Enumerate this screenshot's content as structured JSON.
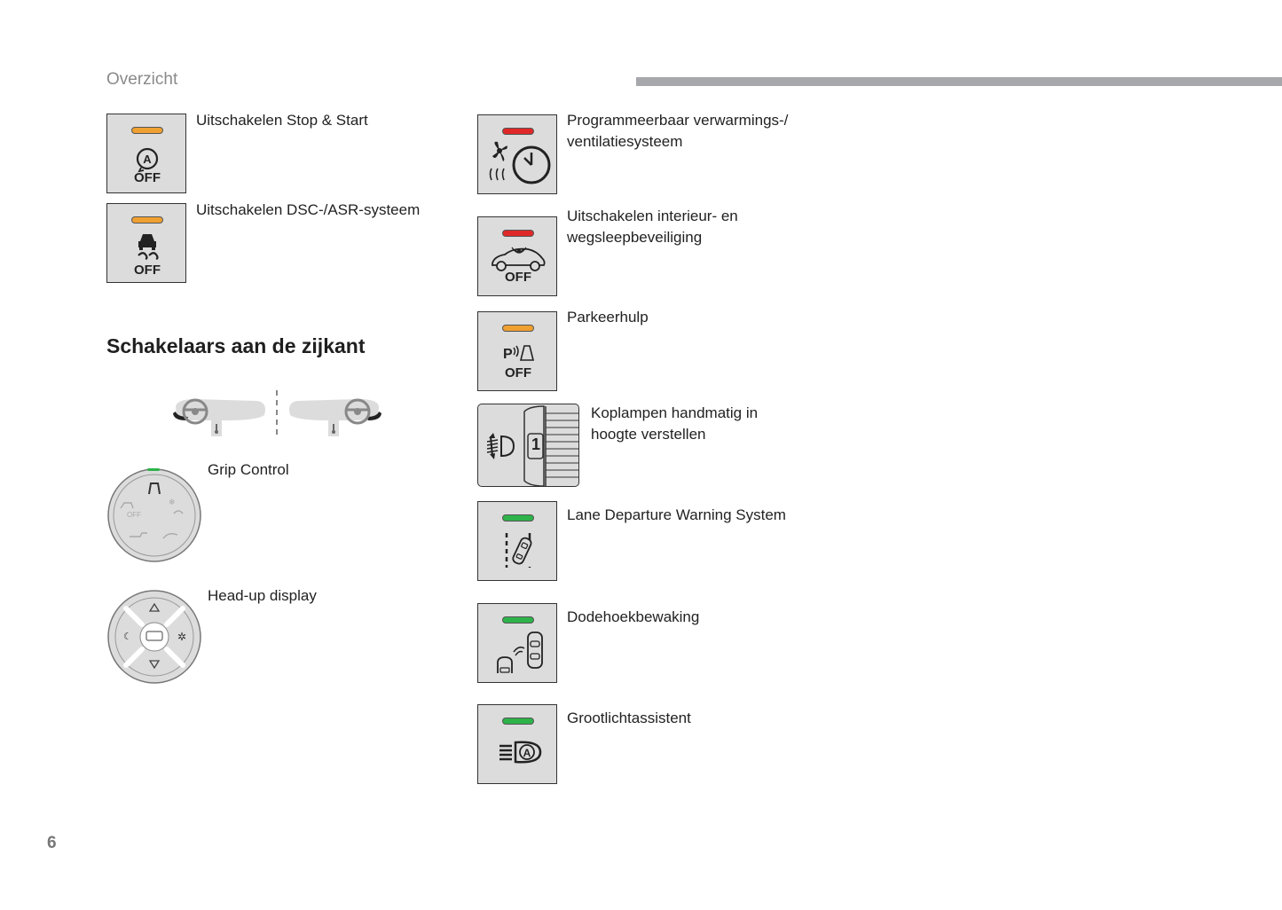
{
  "header": {
    "section": "Overzicht"
  },
  "page_number": "6",
  "colors": {
    "led_orange": "#f0a030",
    "led_red": "#e02828",
    "led_green": "#2db34a",
    "button_bg": "#dcdcdc",
    "header_bar": "#a7a8ac"
  },
  "left_buttons": [
    {
      "label": "Uitschakelen Stop & Start",
      "icon": "stop-start-off-icon",
      "led": "orange",
      "icon_text": "OFF"
    },
    {
      "label": "Uitschakelen DSC-/ASR-systeem",
      "icon": "dsc-asr-off-icon",
      "led": "orange",
      "icon_text": "OFF"
    }
  ],
  "side_switches": {
    "heading": "Schakelaars aan de zijkant",
    "items": [
      {
        "label": "Grip Control",
        "icon": "grip-control-dial-icon",
        "icon_text": "OFF"
      },
      {
        "label": "Head-up display",
        "icon": "head-up-display-control-icon"
      }
    ]
  },
  "right_buttons": [
    {
      "label_lines": [
        "Programmeerbaar verwarmings-/",
        "ventilatiesysteem"
      ],
      "icon": "programmable-heating-icon",
      "led": "red"
    },
    {
      "label_lines": [
        "Uitschakelen interieur- en",
        "wegsleepbeveiliging"
      ],
      "icon": "alarm-off-icon",
      "led": "red",
      "icon_text": "OFF"
    },
    {
      "label_lines": [
        "Parkeerhulp"
      ],
      "icon": "park-assist-off-icon",
      "led": "orange",
      "icon_text": "OFF"
    },
    {
      "label_lines": [
        "Koplampen handmatig in",
        "hoogte verstellen"
      ],
      "icon": "headlamp-height-wheel-icon",
      "icon_text": "1"
    },
    {
      "label_lines": [
        "Lane Departure Warning System"
      ],
      "icon": "lane-departure-icon",
      "led": "green"
    },
    {
      "label_lines": [
        "Dodehoekbewaking"
      ],
      "icon": "blind-spot-icon",
      "led": "green"
    },
    {
      "label_lines": [
        "Grootlichtassistent"
      ],
      "icon": "high-beam-assist-icon",
      "led": "green"
    }
  ]
}
